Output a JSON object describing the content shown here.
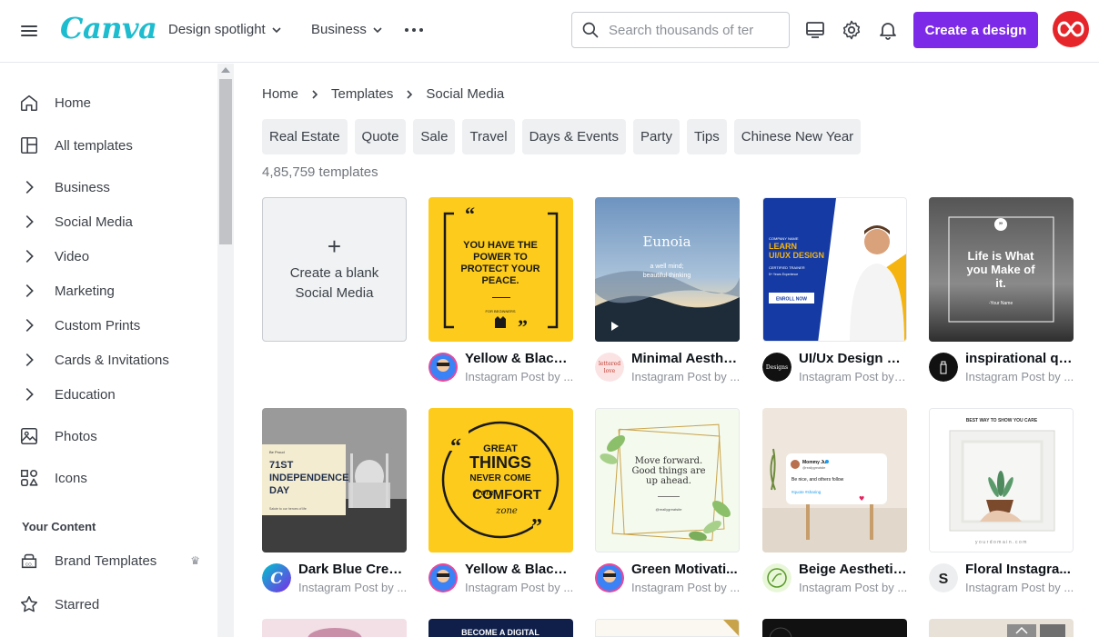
{
  "header": {
    "logo_text": "Canva",
    "nav": [
      {
        "label": "Design spotlight"
      },
      {
        "label": "Business"
      }
    ],
    "search_placeholder": "Search thousands of ter",
    "create_label": "Create a design",
    "colors": {
      "accent": "#7d2ae8",
      "logo": "#1dbccf",
      "avatar": "#e5252a"
    }
  },
  "sidebar": {
    "items": [
      {
        "label": "Home",
        "icon": "home-icon"
      },
      {
        "label": "All templates",
        "icon": "templates-icon"
      },
      {
        "label": "Business",
        "icon": "chevron-right-icon"
      },
      {
        "label": "Social Media",
        "icon": "chevron-right-icon"
      },
      {
        "label": "Video",
        "icon": "chevron-right-icon"
      },
      {
        "label": "Marketing",
        "icon": "chevron-right-icon"
      },
      {
        "label": "Custom Prints",
        "icon": "chevron-right-icon"
      },
      {
        "label": "Cards & Invitations",
        "icon": "chevron-right-icon"
      },
      {
        "label": "Education",
        "icon": "chevron-right-icon"
      },
      {
        "label": "Photos",
        "icon": "photo-icon"
      },
      {
        "label": "Icons",
        "icon": "shapes-icon"
      }
    ],
    "your_content_heading": "Your Content",
    "content_items": [
      {
        "label": "Brand Templates",
        "icon": "brand-icon",
        "badge": "crown-icon"
      },
      {
        "label": "Starred",
        "icon": "star-icon"
      }
    ]
  },
  "breadcrumb": [
    "Home",
    "Templates",
    "Social Media"
  ],
  "chips": [
    "Real Estate",
    "Quote",
    "Sale",
    "Travel",
    "Days & Events",
    "Party",
    "Tips",
    "Chinese New Year"
  ],
  "template_count": "4,85,759 templates",
  "blank_card": {
    "line1": "Create a blank",
    "line2": "Social Media"
  },
  "templates": [
    {
      "title": "Yellow & Black ...",
      "sub": "Instagram Post by ...",
      "lines": [
        "YOU HAVE THE",
        "POWER TO",
        "PROTECT YOUR",
        "PEACE."
      ],
      "small": "FOR BEGINNERS"
    },
    {
      "title": "Minimal Aesthe...",
      "sub": "Instagram Post by ...",
      "lines": [
        "Eunoia",
        "a well mind;",
        "beautiful thinking"
      ],
      "avatar_text": "lettered love"
    },
    {
      "title": "UI/Ux Design Tr...",
      "sub": "Instagram Post by I...",
      "lines": [
        "COMPANY NAME",
        "LEARN",
        "UI/UX DESIGN",
        "CERTIFIED TRAINER",
        "5+ Years Experience",
        "ENROLL NOW"
      ],
      "avatar_text": "Designs"
    },
    {
      "title": "inspirational qo...",
      "sub": "Instagram Post by ...",
      "lines": [
        "Life is What",
        "you Make of",
        "it.",
        "-Your Name"
      ]
    },
    {
      "title": "Dark Blue Crea...",
      "sub": "Instagram Post by ...",
      "lines": [
        "Be Proud",
        "71ST",
        "INDEPENDENCE",
        "DAY",
        "Salute to our heroes of life"
      ]
    },
    {
      "title": "Yellow & Black ...",
      "sub": "Instagram Post by ...",
      "lines": [
        "GREAT",
        "THINGS",
        "NEVER COME",
        "from",
        "COMFORT",
        "zone"
      ]
    },
    {
      "title": "Green Motivati...",
      "sub": "Instagram Post by ...",
      "lines": [
        "Move forward.",
        "Good things are",
        "up ahead.",
        "@reallygreatsite"
      ]
    },
    {
      "title": "Beige Aesthetic...",
      "sub": "Instagram Post by ...",
      "lines": [
        "Mommy Jul",
        "@reallygreatsite",
        "Be nice, and others follow",
        "#quote #sharing"
      ]
    },
    {
      "title": "Floral Instagra...",
      "sub": "Instagram Post by ...",
      "lines": [
        "BEST WAY TO SHOW YOU CARE",
        "yourdomain.com"
      ]
    }
  ],
  "peek_row_text": "BECOME A DIGITAL"
}
